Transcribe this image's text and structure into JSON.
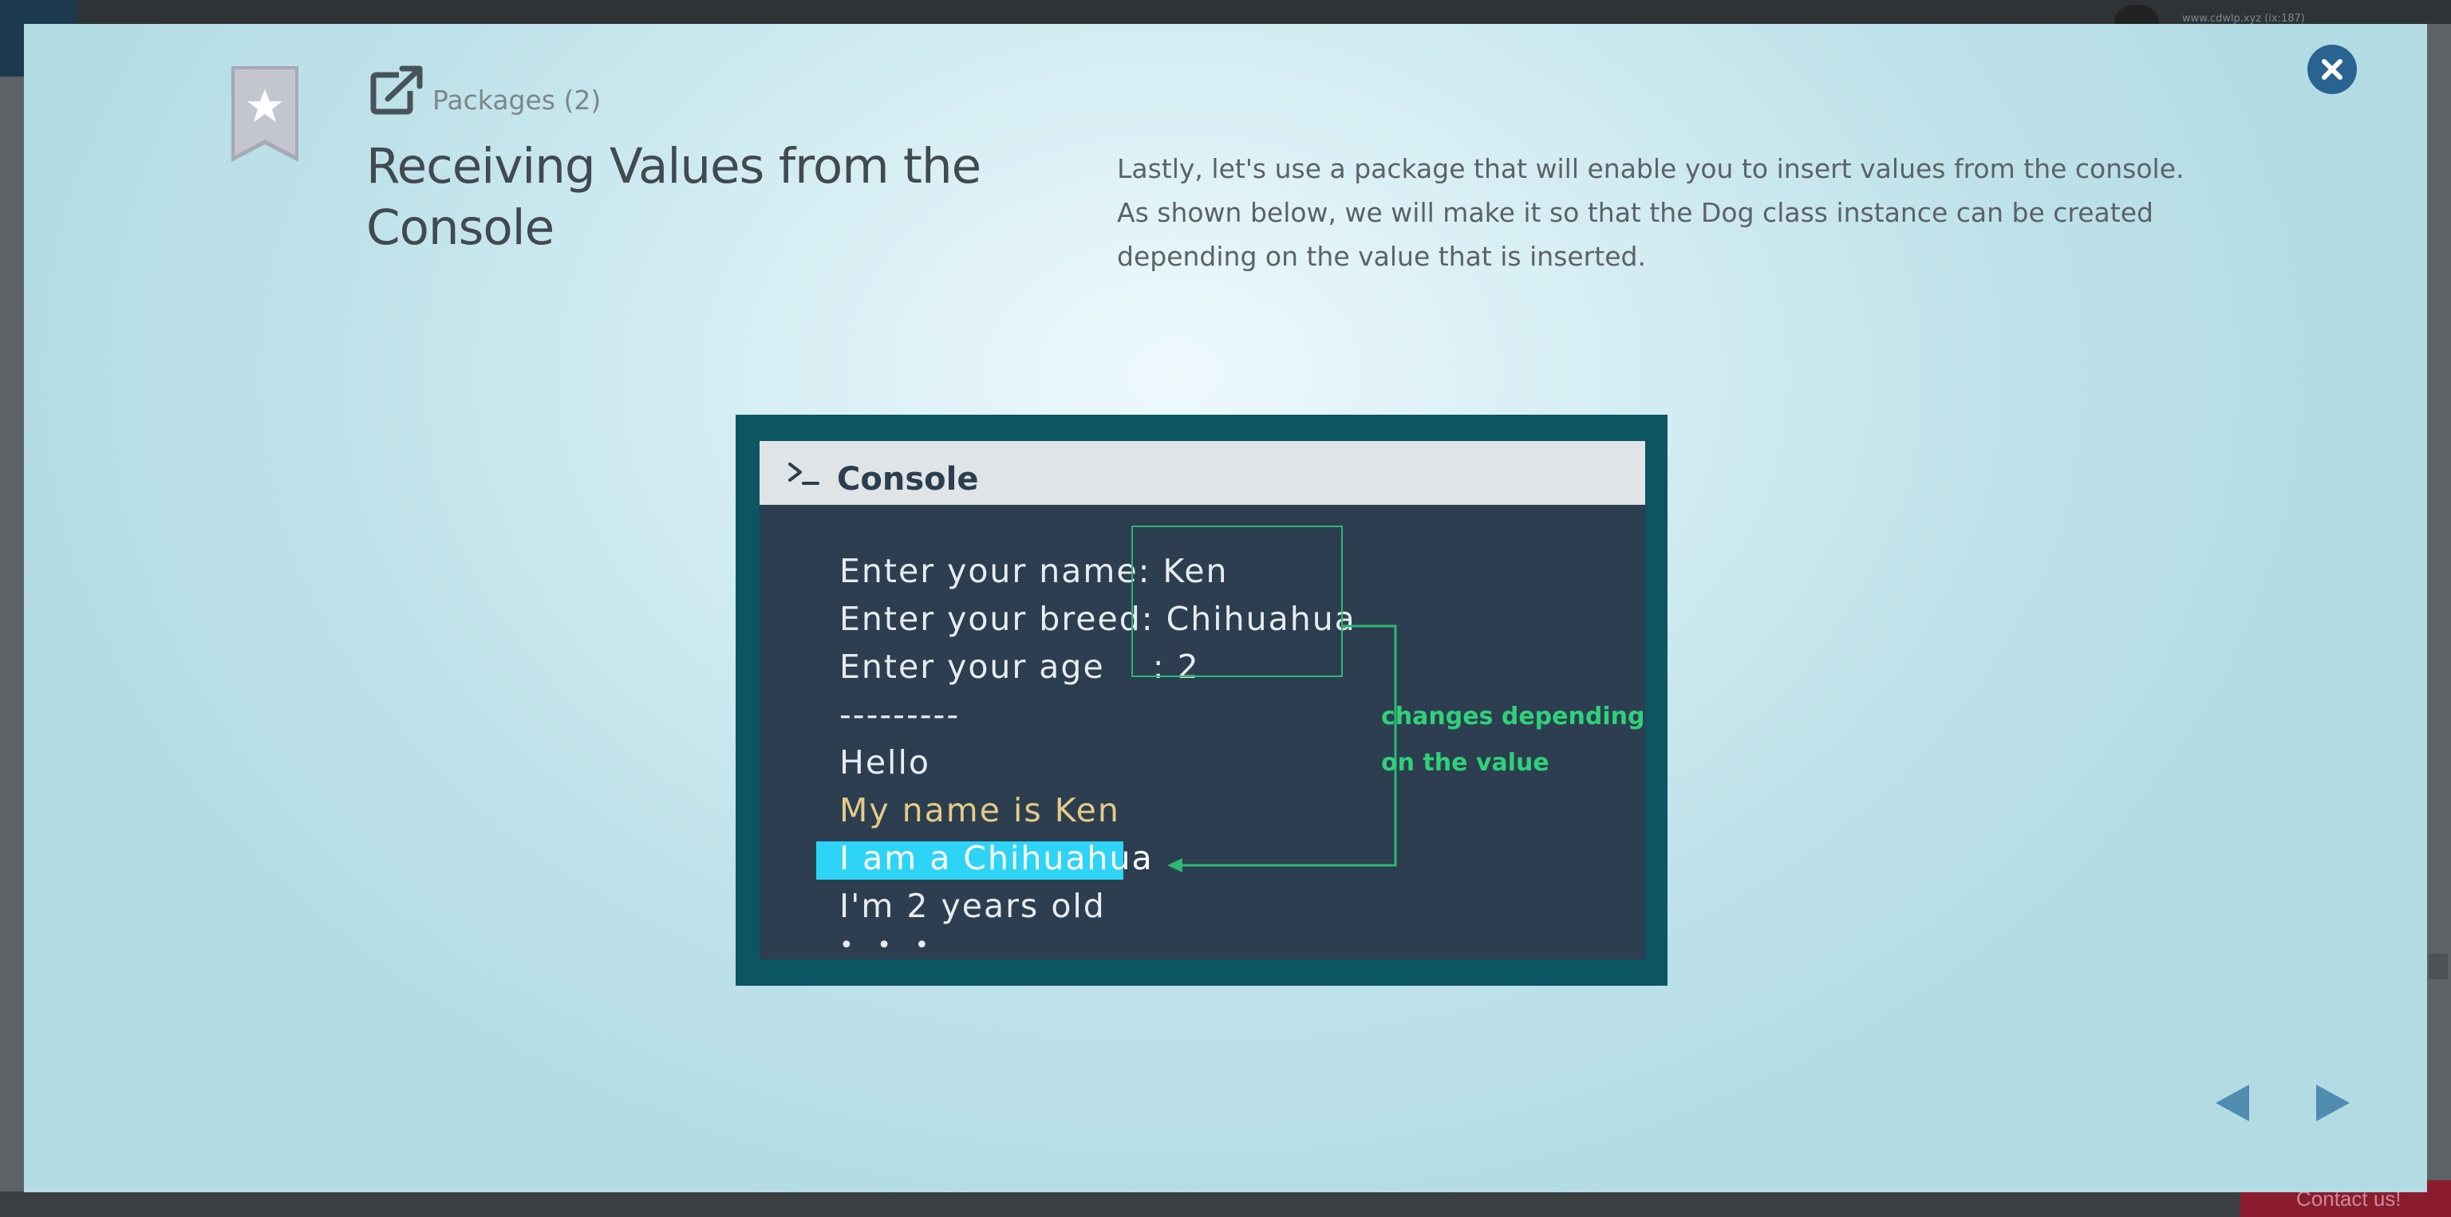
{
  "background": {
    "url_text": "www.cdwlp.xyz (ix:187)",
    "contact_label": "Contact us!"
  },
  "header": {
    "breadcrumb": "Packages (2)",
    "title": "Receiving Values from the Console",
    "description": "Lastly, let's use a package that will enable you to insert values from the console. As shown below, we will make it so that the Dog class instance can be created depending on the value that is inserted."
  },
  "console": {
    "title": "Console",
    "lines": {
      "name": "Enter your name: Ken",
      "breed": "Enter your breed: Chihuahua",
      "age": "Enter your age    : 2",
      "separator": "---------",
      "hello": "Hello",
      "myname": "My name is Ken",
      "iam": "I am a Chihuahua",
      "years": "I'm 2 years old",
      "ellipsis": "• • •"
    },
    "annotation_line1": "changes depending",
    "annotation_line2": "on the value"
  },
  "icons": {
    "close": "close-icon",
    "bookmark": "bookmark-star-icon",
    "external": "external-link-icon",
    "prompt": "terminal-prompt-icon",
    "prev": "triangle-left-icon",
    "next": "triangle-right-icon"
  },
  "colors": {
    "accent": "#28648f",
    "console_bg": "#2c3e50",
    "figure_border": "#0c5563",
    "annotation_green": "#2fd17a",
    "highlight": "#2ed4f5",
    "yellow_text": "#e4cb85"
  }
}
